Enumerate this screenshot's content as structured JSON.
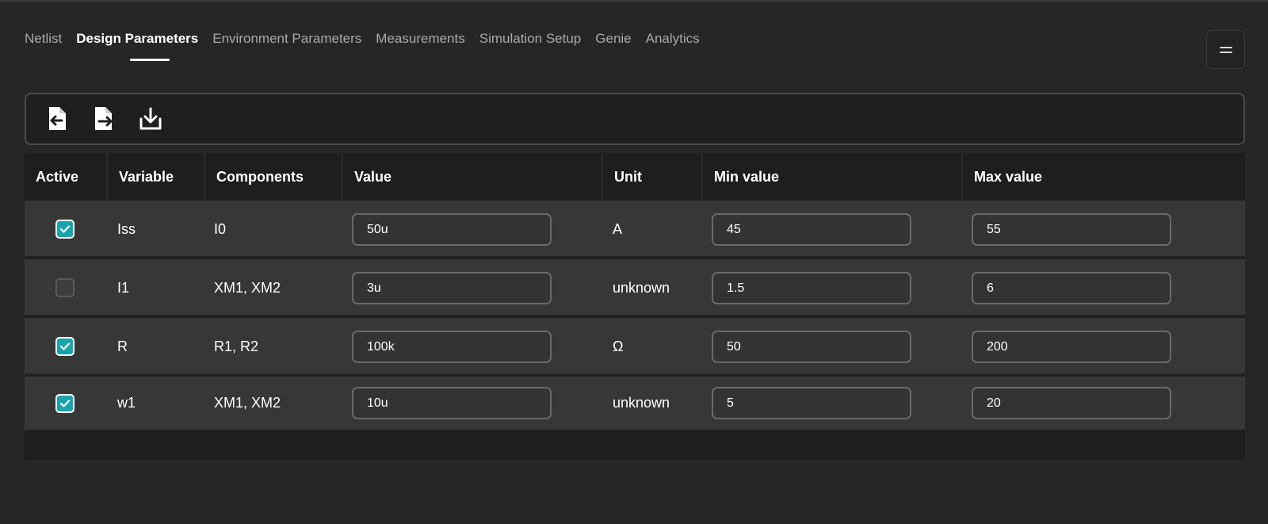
{
  "tabs": [
    {
      "label": "Netlist",
      "active": false
    },
    {
      "label": "Design Parameters",
      "active": true
    },
    {
      "label": "Environment Parameters",
      "active": false
    },
    {
      "label": "Measurements",
      "active": false
    },
    {
      "label": "Simulation Setup",
      "active": false
    },
    {
      "label": "Genie",
      "active": false
    },
    {
      "label": "Analytics",
      "active": false
    }
  ],
  "toolbar": {
    "icons": [
      "file-import-icon",
      "file-export-icon",
      "download-icon"
    ]
  },
  "table": {
    "headers": [
      "Active",
      "Variable",
      "Components",
      "Value",
      "Unit",
      "Min value",
      "Max value"
    ],
    "rows": [
      {
        "active": true,
        "variable": "Iss",
        "components": "I0",
        "value": "50u",
        "unit": "A",
        "min": "45",
        "max": "55"
      },
      {
        "active": false,
        "variable": "I1",
        "components": "XM1, XM2",
        "value": "3u",
        "unit": "unknown",
        "min": "1.5",
        "max": "6"
      },
      {
        "active": true,
        "variable": "R",
        "components": "R1, R2",
        "value": "100k",
        "unit": "Ω",
        "min": "50",
        "max": "200"
      },
      {
        "active": true,
        "variable": "w1",
        "components": "XM1, XM2",
        "value": "10u",
        "unit": "unknown",
        "min": "5",
        "max": "20"
      }
    ]
  },
  "colors": {
    "accent": "#1aa3ad",
    "background": "#262626",
    "row": "#373737"
  }
}
